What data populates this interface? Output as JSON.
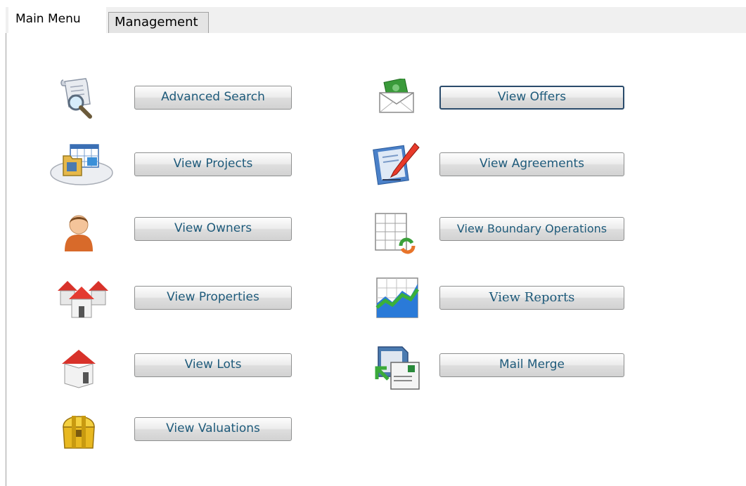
{
  "tabs": [
    {
      "label": "Main Menu",
      "active": true
    },
    {
      "label": "Management",
      "active": false
    }
  ],
  "left_buttons": [
    {
      "label": "Advanced Search",
      "icon": "document-search-icon"
    },
    {
      "label": "View Projects",
      "icon": "calendar-folder-icon"
    },
    {
      "label": "View Owners",
      "icon": "person-icon"
    },
    {
      "label": "View Properties",
      "icon": "houses-icon"
    },
    {
      "label": "View Lots",
      "icon": "house-icon"
    },
    {
      "label": "View Valuations",
      "icon": "treasure-chest-icon"
    }
  ],
  "right_buttons": [
    {
      "label": "View Offers",
      "icon": "money-envelope-icon"
    },
    {
      "label": "View Agreements",
      "icon": "document-pen-icon"
    },
    {
      "label": "View Boundary Operations",
      "icon": "grid-refresh-icon"
    },
    {
      "label": "View Reports",
      "icon": "chart-icon"
    },
    {
      "label": "Mail Merge",
      "icon": "mail-merge-icon"
    }
  ]
}
